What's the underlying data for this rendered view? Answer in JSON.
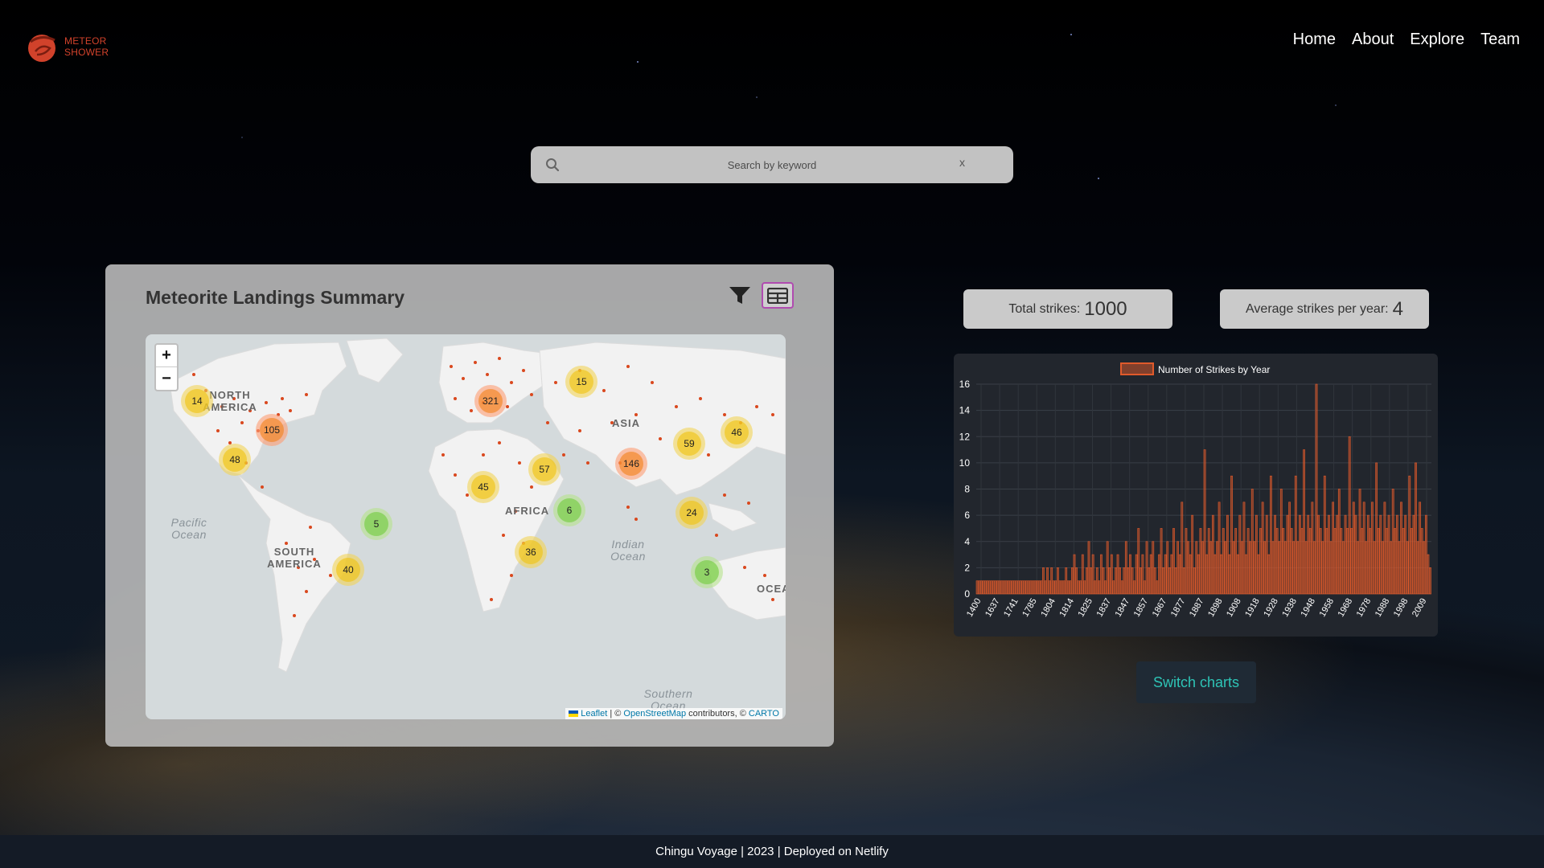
{
  "brand": {
    "line1": "METEOR",
    "line2": "SHOWER",
    "color": "#d1422b"
  },
  "nav": [
    {
      "label": "Home"
    },
    {
      "label": "About"
    },
    {
      "label": "Explore"
    },
    {
      "label": "Team"
    }
  ],
  "search": {
    "placeholder": "Search by keyword",
    "value": "",
    "clear": "x"
  },
  "summary": {
    "title": "Meteorite Landings Summary",
    "map": {
      "zoom_in": "+",
      "zoom_out": "−",
      "labels": {
        "north_america": "NORTH AMERICA",
        "south_america": "SOUTH AMERICA",
        "africa": "AFRICA",
        "asia": "ASIA",
        "oceania": "OCEA"
      },
      "oceans": {
        "pacific": "Pacific Ocean",
        "indian": "Indian Ocean",
        "southern": "Southern Ocean"
      },
      "clusters": [
        {
          "count": "14",
          "level": "y"
        },
        {
          "count": "105",
          "level": "o"
        },
        {
          "count": "48",
          "level": "y"
        },
        {
          "count": "321",
          "level": "o"
        },
        {
          "count": "15",
          "level": "y"
        },
        {
          "count": "59",
          "level": "y"
        },
        {
          "count": "46",
          "level": "y"
        },
        {
          "count": "146",
          "level": "o"
        },
        {
          "count": "57",
          "level": "y"
        },
        {
          "count": "45",
          "level": "y"
        },
        {
          "count": "6",
          "level": "g"
        },
        {
          "count": "5",
          "level": "g"
        },
        {
          "count": "24",
          "level": "y"
        },
        {
          "count": "36",
          "level": "y"
        },
        {
          "count": "40",
          "level": "y"
        },
        {
          "count": "3",
          "level": "g"
        }
      ],
      "attribution": {
        "leaflet": "Leaflet",
        "sep1": "| ©",
        "osm": "OpenStreetMap",
        "contrib": "contributors, ©",
        "carto": "CARTO"
      }
    }
  },
  "stats": {
    "total_label": "Total strikes:",
    "total_value": "1000",
    "avg_label": "Average strikes per year:",
    "avg_value": "4"
  },
  "switch_label": "Switch charts",
  "footer": "Chingu Voyage | 2023 | Deployed on Netlify",
  "colors": {
    "bar": "#e05a2b",
    "bar_fill": "rgba(224,90,43,0.5)",
    "chart_bg": "#22262d",
    "accent_button_text": "#2ec4b6"
  },
  "chart_data": {
    "type": "bar",
    "legend": "Number of Strikes by Year",
    "legend_position": "top",
    "ylim": [
      0,
      16
    ],
    "yticks": [
      0,
      2,
      4,
      6,
      8,
      10,
      12,
      14,
      16
    ],
    "grid": true,
    "xtick_labels": [
      "1400",
      "1637",
      "1741",
      "1785",
      "1804",
      "1814",
      "1825",
      "1837",
      "1847",
      "1857",
      "1867",
      "1877",
      "1887",
      "1898",
      "1908",
      "1918",
      "1928",
      "1938",
      "1948",
      "1958",
      "1968",
      "1978",
      "1988",
      "1998",
      "2009"
    ],
    "values": [
      1,
      1,
      1,
      1,
      1,
      1,
      1,
      1,
      1,
      1,
      1,
      1,
      1,
      1,
      1,
      1,
      1,
      1,
      1,
      1,
      1,
      1,
      1,
      1,
      1,
      1,
      1,
      1,
      1,
      1,
      1,
      1,
      2,
      1,
      2,
      1,
      2,
      1,
      1,
      2,
      1,
      1,
      1,
      2,
      1,
      1,
      2,
      3,
      2,
      1,
      1,
      3,
      1,
      2,
      4,
      2,
      3,
      1,
      2,
      1,
      3,
      2,
      1,
      4,
      2,
      3,
      1,
      2,
      3,
      2,
      1,
      2,
      4,
      2,
      3,
      2,
      1,
      3,
      5,
      2,
      3,
      1,
      4,
      2,
      3,
      4,
      2,
      1,
      3,
      5,
      2,
      3,
      4,
      2,
      3,
      5,
      2,
      4,
      3,
      7,
      2,
      5,
      4,
      3,
      6,
      2,
      4,
      3,
      5,
      4,
      11,
      3,
      5,
      4,
      6,
      3,
      4,
      7,
      3,
      5,
      4,
      6,
      3,
      9,
      4,
      5,
      3,
      6,
      4,
      7,
      3,
      5,
      4,
      8,
      4,
      6,
      3,
      5,
      7,
      4,
      6,
      3,
      9,
      4,
      6,
      5,
      4,
      8,
      5,
      4,
      6,
      7,
      5,
      4,
      9,
      4,
      6,
      5,
      11,
      4,
      6,
      5,
      7,
      4,
      16,
      6,
      5,
      4,
      9,
      5,
      6,
      4,
      7,
      5,
      6,
      8,
      5,
      4,
      6,
      5,
      12,
      5,
      7,
      6,
      4,
      8,
      5,
      7,
      4,
      6,
      5,
      7,
      4,
      10,
      5,
      6,
      4,
      7,
      5,
      6,
      4,
      8,
      5,
      6,
      4,
      7,
      5,
      6,
      4,
      9,
      5,
      6,
      10,
      4,
      7,
      5,
      4,
      6,
      3,
      2
    ]
  }
}
